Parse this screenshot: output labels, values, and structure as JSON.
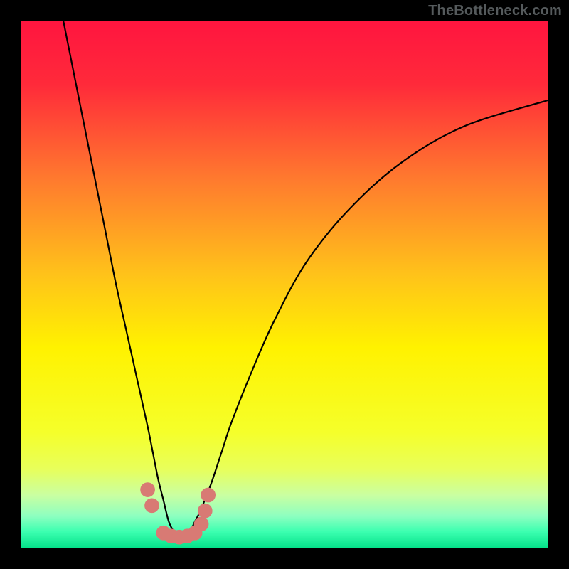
{
  "watermark": "TheBottleneck.com",
  "chart_data": {
    "type": "line",
    "title": "",
    "xlabel": "",
    "ylabel": "",
    "xlim": [
      0,
      100
    ],
    "ylim": [
      0,
      100
    ],
    "background_gradient_stops": [
      {
        "pct": 0,
        "color": "#ff153f"
      },
      {
        "pct": 12,
        "color": "#ff2a3a"
      },
      {
        "pct": 30,
        "color": "#ff7a2e"
      },
      {
        "pct": 48,
        "color": "#ffc21a"
      },
      {
        "pct": 62,
        "color": "#fff200"
      },
      {
        "pct": 78,
        "color": "#f5ff2a"
      },
      {
        "pct": 85,
        "color": "#e8ff5a"
      },
      {
        "pct": 90,
        "color": "#caffa1"
      },
      {
        "pct": 94,
        "color": "#8dffc0"
      },
      {
        "pct": 97,
        "color": "#3bffb0"
      },
      {
        "pct": 100,
        "color": "#05e28a"
      }
    ],
    "series": [
      {
        "name": "bottleneck-curve",
        "color": "#000000",
        "x": [
          8,
          10,
          12,
          14,
          16,
          18,
          20,
          22,
          24,
          25,
          26,
          27,
          28,
          29,
          30,
          31,
          32,
          33,
          34,
          36,
          38,
          40,
          44,
          48,
          54,
          62,
          72,
          84,
          100
        ],
        "y": [
          100,
          90,
          80,
          70,
          60,
          50,
          41,
          32,
          23,
          18,
          13,
          9,
          5,
          3,
          2,
          2,
          3,
          5,
          7,
          12,
          18,
          24,
          34,
          43,
          54,
          64,
          73,
          80,
          85
        ]
      }
    ],
    "markers": {
      "name": "highlight-dots",
      "color": "#d87a74",
      "radius_pct": 1.4,
      "x": [
        24.0,
        24.8,
        27.0,
        28.5,
        30.0,
        31.5,
        33.0,
        34.2,
        34.9,
        35.5
      ],
      "y": [
        11.0,
        8.0,
        2.8,
        2.2,
        2.0,
        2.2,
        2.8,
        4.5,
        7.0,
        10.0
      ]
    }
  }
}
